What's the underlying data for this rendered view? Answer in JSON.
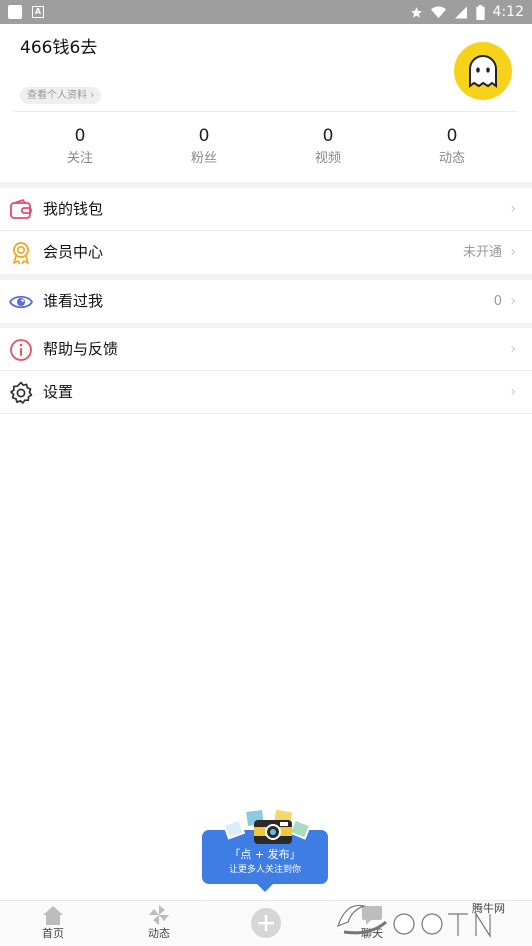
{
  "status_bar": {
    "time": "4:12"
  },
  "profile": {
    "username": "466钱6去",
    "view_profile_label": "查看个人资料 ›",
    "stats": [
      {
        "value": "0",
        "label": "关注"
      },
      {
        "value": "0",
        "label": "粉丝"
      },
      {
        "value": "0",
        "label": "视频"
      },
      {
        "value": "0",
        "label": "动态"
      }
    ]
  },
  "menu": {
    "wallet": {
      "label": "我的钱包",
      "icon": "wallet-icon"
    },
    "vip": {
      "label": "会员中心",
      "value": "未开通",
      "icon": "medal-icon"
    },
    "visitors": {
      "label": "谁看过我",
      "value": "0",
      "icon": "eye-icon"
    },
    "help": {
      "label": "帮助与反馈",
      "icon": "info-icon"
    },
    "settings": {
      "label": "设置",
      "icon": "gear-icon"
    }
  },
  "publish_popup": {
    "title": "「点 + 发布」",
    "subtitle": "让更多人关注到你"
  },
  "bottom_nav": {
    "home": "首页",
    "moments": "动态",
    "chat": "聊天"
  },
  "watermark": {
    "text": "腾牛网"
  },
  "colors": {
    "accent_blue": "#3e7de4",
    "avatar_yellow": "#f7d21b"
  }
}
